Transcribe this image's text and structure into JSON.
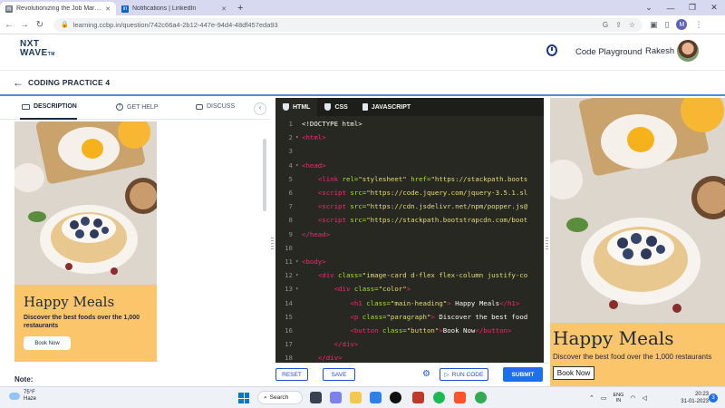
{
  "browser": {
    "tabs": [
      {
        "title": "Revolutionizing the Job Market |",
        "active": true,
        "favicon_color": "#6b7280"
      },
      {
        "title": "Notifications | LinkedIn",
        "active": false,
        "favicon_color": "#0a66c2"
      }
    ],
    "url": "learning.ccbp.in/question/742c66a4-2b12-447e-94d4-48df457eda93",
    "profile_initial": "M"
  },
  "app": {
    "logo_line1": "NXT",
    "logo_line2": "WAVE",
    "logo_tm": "TM",
    "code_playground": "Code Playground",
    "username": "Rakesh",
    "page_title": "CODING PRACTICE 4"
  },
  "left_panel": {
    "tabs": {
      "description": "DESCRIPTION",
      "get_help": "GET HELP",
      "discuss": "DISCUSS"
    },
    "preview": {
      "heading": "Happy Meals",
      "paragraph": "Discover the best foods over the 1,000 restaurants",
      "button": "Book Now"
    },
    "note_label": "Note:"
  },
  "editor": {
    "tabs": {
      "html": "HTML",
      "css": "CSS",
      "javascript": "JAVASCRIPT"
    },
    "lines": [
      {
        "n": "1",
        "fold": "",
        "indent": "",
        "parts": [
          [
            "t",
            "<!DOCTYPE html>"
          ]
        ]
      },
      {
        "n": "2",
        "fold": "▾",
        "indent": "",
        "parts": [
          [
            "tg",
            "<html>"
          ]
        ]
      },
      {
        "n": "3",
        "fold": "",
        "indent": "",
        "parts": []
      },
      {
        "n": "4",
        "fold": "▾",
        "indent": "",
        "parts": [
          [
            "tg",
            "<head>"
          ]
        ]
      },
      {
        "n": "5",
        "fold": "",
        "indent": "    ",
        "parts": [
          [
            "tg",
            "<link "
          ],
          [
            "at",
            "rel="
          ],
          [
            "st",
            "\"stylesheet\" "
          ],
          [
            "at",
            "href="
          ],
          [
            "st",
            "\"https://stackpath.boots"
          ]
        ]
      },
      {
        "n": "6",
        "fold": "",
        "indent": "    ",
        "parts": [
          [
            "tg",
            "<script "
          ],
          [
            "at",
            "src="
          ],
          [
            "st",
            "\"https://code.jquery.com/jquery-3.5.1.sl"
          ]
        ]
      },
      {
        "n": "7",
        "fold": "",
        "indent": "    ",
        "parts": [
          [
            "tg",
            "<script "
          ],
          [
            "at",
            "src="
          ],
          [
            "st",
            "\"https://cdn.jsdelivr.net/npm/popper.js@"
          ]
        ]
      },
      {
        "n": "8",
        "fold": "",
        "indent": "    ",
        "parts": [
          [
            "tg",
            "<script "
          ],
          [
            "at",
            "src="
          ],
          [
            "st",
            "\"https://stackpath.bootstrapcdn.com/boot"
          ]
        ]
      },
      {
        "n": "9",
        "fold": "",
        "indent": "",
        "parts": [
          [
            "tg",
            "</head>"
          ]
        ]
      },
      {
        "n": "10",
        "fold": "",
        "indent": "",
        "parts": []
      },
      {
        "n": "11",
        "fold": "▾",
        "indent": "",
        "parts": [
          [
            "tg",
            "<body>"
          ]
        ]
      },
      {
        "n": "12",
        "fold": "▾",
        "indent": "    ",
        "parts": [
          [
            "tg",
            "<div "
          ],
          [
            "at",
            "class="
          ],
          [
            "st",
            "\"image-card d-flex flex-column justify-co"
          ]
        ]
      },
      {
        "n": "13",
        "fold": "▾",
        "indent": "        ",
        "parts": [
          [
            "tg",
            "<div "
          ],
          [
            "at",
            "class="
          ],
          [
            "st",
            "\"color\""
          ],
          [
            "tg",
            ">"
          ]
        ]
      },
      {
        "n": "14",
        "fold": "",
        "indent": "            ",
        "parts": [
          [
            "tg",
            "<h1 "
          ],
          [
            "at",
            "class="
          ],
          [
            "st",
            "\"main-heading\""
          ],
          [
            "tg",
            "> "
          ],
          [
            "t",
            "Happy Meals"
          ],
          [
            "tg",
            "</h1>"
          ]
        ]
      },
      {
        "n": "15",
        "fold": "",
        "indent": "            ",
        "parts": [
          [
            "tg",
            "<p "
          ],
          [
            "at",
            "class="
          ],
          [
            "st",
            "\"paragraph\""
          ],
          [
            "tg",
            "> "
          ],
          [
            "t",
            "Discover the best food"
          ]
        ]
      },
      {
        "n": "16",
        "fold": "",
        "indent": "            ",
        "parts": [
          [
            "tg",
            "<button "
          ],
          [
            "at",
            "class="
          ],
          [
            "st",
            "\"button\""
          ],
          [
            "tg",
            ">"
          ],
          [
            "t",
            "Book Now"
          ],
          [
            "tg",
            "</button>"
          ]
        ]
      },
      {
        "n": "17",
        "fold": "",
        "indent": "        ",
        "parts": [
          [
            "tg",
            "</div>"
          ]
        ]
      },
      {
        "n": "18",
        "fold": "",
        "indent": "    ",
        "parts": [
          [
            "tg",
            "</div>"
          ]
        ]
      }
    ],
    "footer": {
      "reset": "RESET",
      "save": "SAVE",
      "run_code": "RUN CODE",
      "submit": "SUBMIT"
    }
  },
  "output": {
    "heading": "Happy Meals",
    "paragraph": "Discover the best food over the 1,000 restaurants",
    "button": "Book Now"
  },
  "taskbar": {
    "temperature": "75°F",
    "condition": "Haze",
    "search": "Search",
    "lang_line1": "ENG",
    "lang_line2": "IN",
    "time": "20:23",
    "date": "31-01-2023",
    "notification_count": "3"
  },
  "colors": {
    "accent_blue": "#1d6feb",
    "card_orange": "#fbc56b",
    "editor_bg": "#272822",
    "header_divider": "#4a90d9"
  }
}
